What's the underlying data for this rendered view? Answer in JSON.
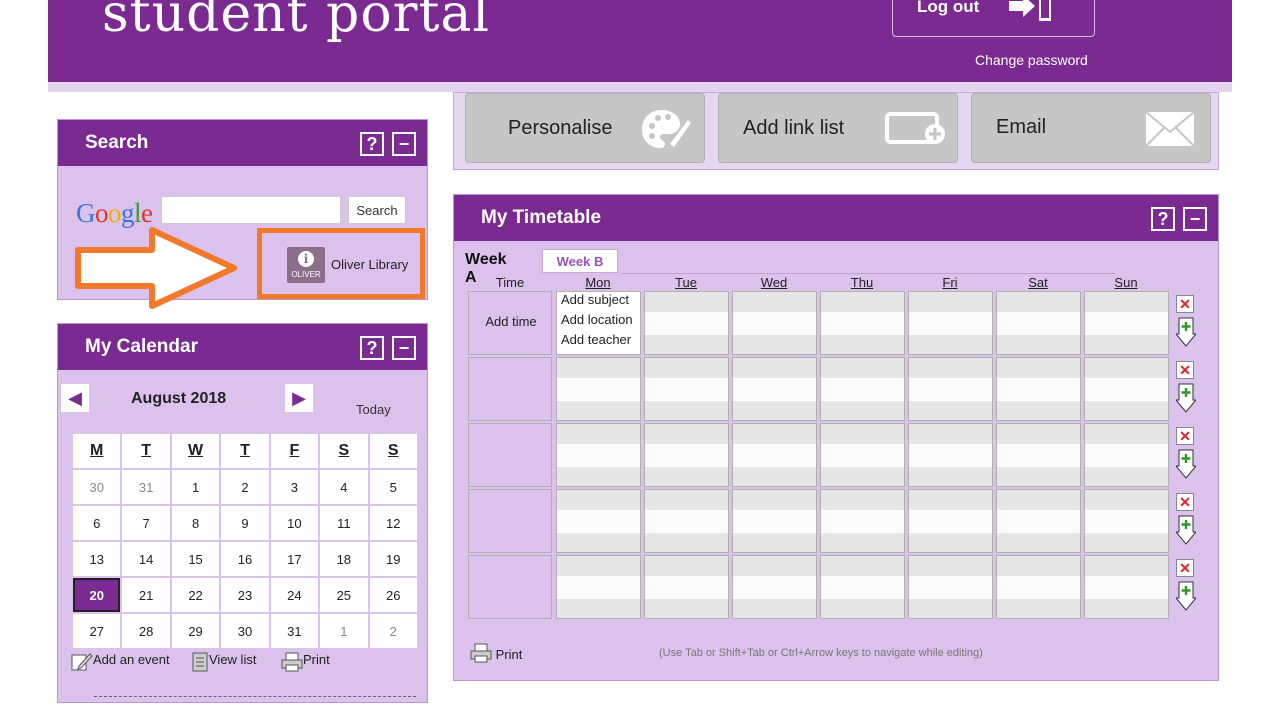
{
  "header": {
    "brand": "student portal",
    "logout_label": "Log out",
    "change_password": "Change password"
  },
  "toolbar": {
    "personalise": "Personalise",
    "add_link_list": "Add link list",
    "email": "Email"
  },
  "search": {
    "title": "Search",
    "help": "?",
    "minimize": "−",
    "google_logo": "Google",
    "input_value": "",
    "button": "Search",
    "oliver_icon_label": "OLIVER",
    "oliver_label": "Oliver Library"
  },
  "calendar": {
    "title": "My Calendar",
    "help": "?",
    "minimize": "−",
    "prev": "◀",
    "next": "▶",
    "month": "August 2018",
    "today": "Today",
    "weekdays": [
      "M",
      "T",
      "W",
      "T",
      "F",
      "S",
      "S"
    ],
    "weeks": [
      [
        "30",
        "31",
        "1",
        "2",
        "3",
        "4",
        "5"
      ],
      [
        "6",
        "7",
        "8",
        "9",
        "10",
        "11",
        "12"
      ],
      [
        "13",
        "14",
        "15",
        "16",
        "17",
        "18",
        "19"
      ],
      [
        "20",
        "21",
        "22",
        "23",
        "24",
        "25",
        "26"
      ],
      [
        "27",
        "28",
        "29",
        "30",
        "31",
        "1",
        "2"
      ]
    ],
    "footer": {
      "add_event": "Add an event",
      "view_list": "View list",
      "print": "Print"
    }
  },
  "timetable": {
    "title": "My Timetable",
    "help": "?",
    "minimize": "−",
    "week_a": "Week A",
    "week_b": "Week B",
    "columns": [
      "Time",
      "Mon",
      "Tue",
      "Wed",
      "Thu",
      "Fri",
      "Sat",
      "Sun"
    ],
    "add_time": "Add time",
    "add_subject": "Add subject",
    "add_location": "Add location",
    "add_teacher": "Add teacher",
    "print": "Print",
    "hint": "(Use Tab or Shift+Tab or Ctrl+Arrow keys to navigate while editing)"
  },
  "colors": {
    "brand": "#7b2a92",
    "panel_bg": "#dbc2ec",
    "highlight": "#f07a2a"
  }
}
